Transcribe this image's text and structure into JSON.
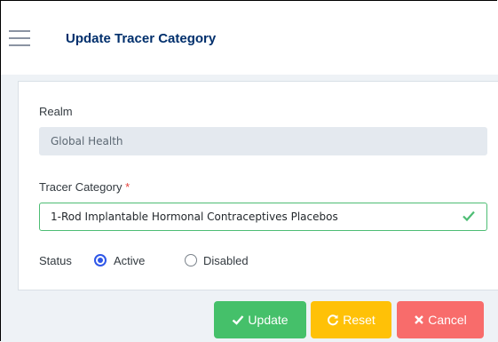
{
  "header": {
    "title": "Update Tracer Category"
  },
  "form": {
    "realm_label": "Realm",
    "realm_value": "Global Health",
    "tracer_label": "Tracer Category",
    "required_marker": "*",
    "tracer_value": "1-Rod Implantable Hormonal Contraceptives Placebos",
    "status_label": "Status",
    "status_options": [
      "Active",
      "Disabled"
    ],
    "status_selected": "Active"
  },
  "buttons": {
    "update": "Update",
    "reset": "Reset",
    "cancel": "Cancel"
  },
  "icons": {
    "menu": "hamburger-icon",
    "valid": "check-icon",
    "update": "check-icon",
    "reset": "refresh-icon",
    "cancel": "close-icon"
  },
  "colors": {
    "title": "#002f6c",
    "valid_border": "#4dbd74",
    "update_button": "#45c06a",
    "reset_button": "#ffc107",
    "cancel_button": "#f86c6b",
    "radio_selected": "#2f57e8"
  }
}
